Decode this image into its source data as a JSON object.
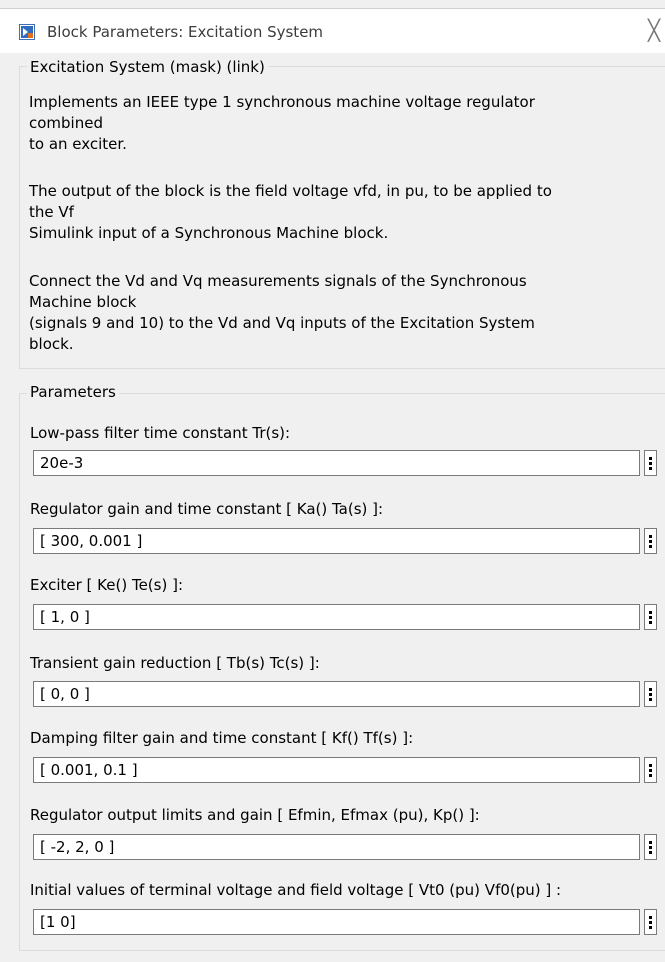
{
  "window": {
    "title": "Block Parameters: Excitation System",
    "icon": "simulink-block-icon",
    "close_icon": "close-icon",
    "close_glyph": "╳"
  },
  "description": {
    "header": "Excitation System (mask) (link)",
    "paragraphs": [
      "Implements an IEEE type 1 synchronous machine voltage regulator\ncombined\nto an exciter.",
      "The output of the block is the field voltage vfd, in pu,  to be applied to\nthe Vf\nSimulink input of a Synchronous Machine block.",
      "Connect the Vd and Vq measurements signals of the Synchronous\nMachine block\n(signals 9 and 10)  to  the Vd and Vq inputs of the Excitation System\nblock."
    ]
  },
  "parameters": {
    "header": "Parameters",
    "fields": [
      {
        "label": "Low-pass filter time constant Tr(s):",
        "value": "20e-3"
      },
      {
        "label": "Regulator gain and time constant [ Ka()  Ta(s) ]:",
        "value": "[ 300, 0.001 ]"
      },
      {
        "label": "Exciter  [ Ke()  Te(s) ]:",
        "value": "[ 1, 0 ]"
      },
      {
        "label": "Transient gain reduction [ Tb(s)  Tc(s) ]:",
        "value": "[ 0, 0 ]"
      },
      {
        "label": "Damping filter gain and time constant  [ Kf()  Tf(s)  ]:",
        "value": "[ 0.001, 0.1 ]"
      },
      {
        "label": "Regulator output limits and gain [ Efmin, Efmax (pu), Kp() ]:",
        "value": "[ -2, 2, 0 ]"
      },
      {
        "label": "Initial values of terminal voltage  and field voltage [ Vt0 (pu) Vf0(pu) ] :",
        "value": "[1 0]"
      }
    ],
    "menu_icon": "vertical-ellipsis-icon"
  }
}
